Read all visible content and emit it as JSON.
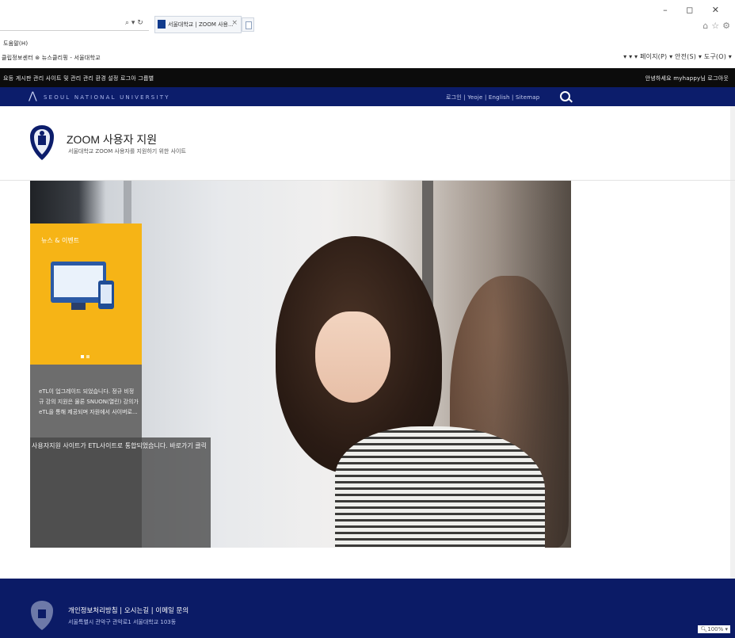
{
  "browser": {
    "tab_title": "서울대학교 | ZOOM 사용...",
    "window_controls": "–  ◻  ✕",
    "menu_label": "도움말(H)",
    "favorites_bar": "클립정보센터  ⊛ 뉴스클리핑 - 서울대학교",
    "command_bar": "▾  ▾  ▾  페이지(P) ▾  안전(S) ▾  도구(O) ▾",
    "zoom_level": "100%"
  },
  "admin_bar": {
    "items": "요등  게시판 관리  사이트 및 관리 관리  환경 설정  로그아  그룹별",
    "user": "안녕하세요 myhappy님  로그아웃"
  },
  "snu_bar": {
    "logo_text": "SEOUL NATIONAL UNIVERSITY",
    "links": "로그인  |  Yeoje  |  English  |  Sitemap"
  },
  "header": {
    "title": "ZOOM 사용자 지원",
    "subtitle": "서울대학교 ZOOM 사용자를 지원하기 위한 사이트"
  },
  "news": {
    "title": "뉴스 & 이벤트",
    "text": "eTL이 업그레이드 되었습니다. 정규 비정규 강의 지원은 물론 SNUON(열린) 강의가 eTL을 통해 제공되며 자원에서 사이버로...",
    "overlay": "사용자지원 사이트가 ETL사이트로 통합되었습니다. 바로가기 클릭"
  },
  "footer": {
    "links": "개인정보처리방침  |  오시는길  |  이메일 문의",
    "address": "서울특별시 관악구 관악로1 서울대학교 103동"
  },
  "colors": {
    "brand_navy": "#0c1d6b",
    "news_yellow": "#f6b416",
    "admin_black": "#0c0c0c"
  }
}
